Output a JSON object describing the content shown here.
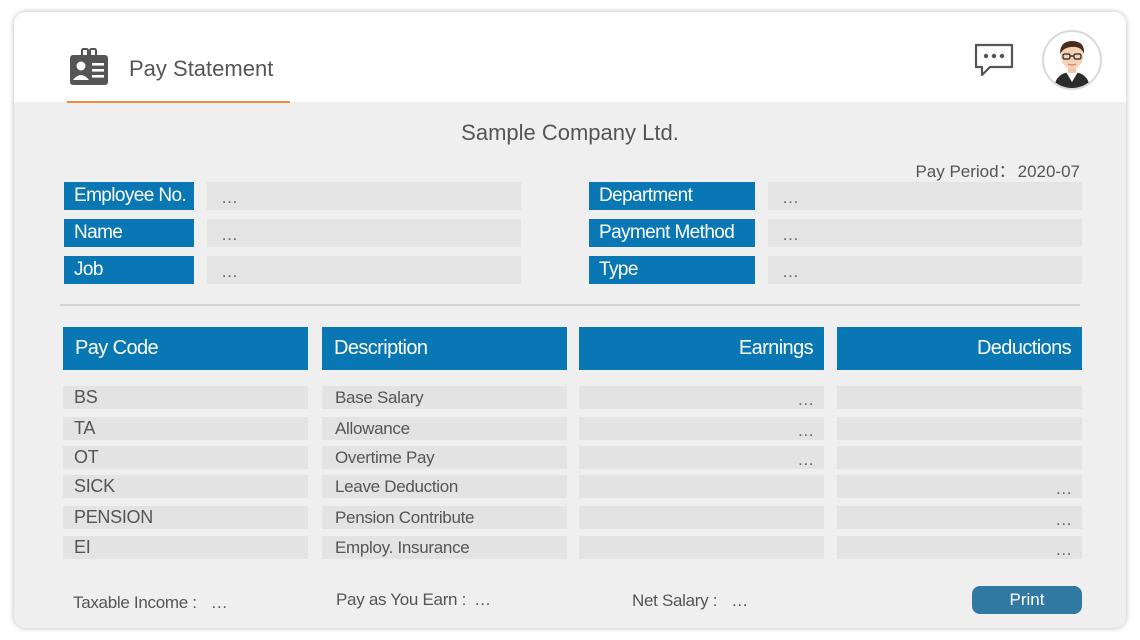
{
  "header": {
    "title": "Pay Statement",
    "app_icon": "employee-id-card-icon",
    "chat_icon": "chat-bubble-icon",
    "avatar_icon": "user-avatar-icon",
    "accent_color": "#ef8a3c"
  },
  "company": "Sample Company Ltd.",
  "pay_period": {
    "label": "Pay Period：",
    "value": "2020-07"
  },
  "info": {
    "employee_no": {
      "label": "Employee No.",
      "value": "…"
    },
    "name": {
      "label": "Name",
      "value": "…"
    },
    "job": {
      "label": "Job",
      "value": "…"
    },
    "department": {
      "label": "Department",
      "value": "…"
    },
    "payment_method": {
      "label": "Payment Method",
      "value": "…"
    },
    "type": {
      "label": "Type",
      "value": "…"
    }
  },
  "table": {
    "header_color": "#0a77b5",
    "columns": [
      "Pay Code",
      "Description",
      "Earnings",
      "Deductions"
    ],
    "rows": [
      {
        "code": "BS",
        "description": "Base Salary",
        "earnings": "…",
        "deductions": ""
      },
      {
        "code": "TA",
        "description": "Allowance",
        "earnings": "…",
        "deductions": ""
      },
      {
        "code": "OT",
        "description": "Overtime Pay",
        "earnings": "…",
        "deductions": ""
      },
      {
        "code": "SICK",
        "description": "Leave Deduction",
        "earnings": "",
        "deductions": "…"
      },
      {
        "code": "PENSION",
        "description": "Pension Contribute",
        "earnings": "",
        "deductions": "…"
      },
      {
        "code": "EI",
        "description": "Employ. Insurance",
        "earnings": "",
        "deductions": "…"
      }
    ]
  },
  "footer": {
    "taxable_income": {
      "label": "Taxable Income :",
      "value": "…"
    },
    "paye": {
      "label": "Pay as You Earn :",
      "value": "…"
    },
    "net_salary": {
      "label": "Net Salary :",
      "value": "…"
    },
    "print_label": "Print"
  }
}
